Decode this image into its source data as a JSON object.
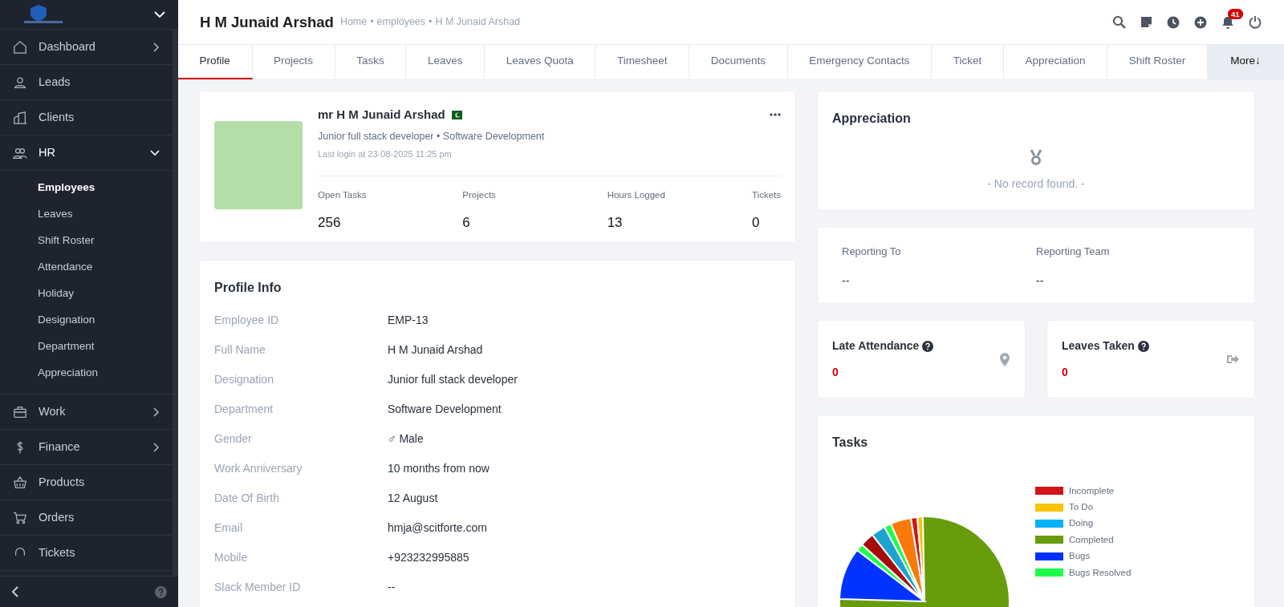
{
  "sidebar": {
    "items": [
      {
        "label": "Dashboard",
        "kind": "home",
        "expandable": true,
        "expanded": false
      },
      {
        "label": "Leads",
        "kind": "user",
        "expandable": false,
        "expanded": false
      },
      {
        "label": "Clients",
        "kind": "building",
        "expandable": false,
        "expanded": false
      },
      {
        "label": "HR",
        "kind": "users",
        "expandable": true,
        "expanded": true,
        "children": [
          {
            "label": "Employees",
            "selected": true
          },
          {
            "label": "Leaves",
            "selected": false
          },
          {
            "label": "Shift Roster",
            "selected": false
          },
          {
            "label": "Attendance",
            "selected": false
          },
          {
            "label": "Holiday",
            "selected": false
          },
          {
            "label": "Designation",
            "selected": false
          },
          {
            "label": "Department",
            "selected": false
          },
          {
            "label": "Appreciation",
            "selected": false
          }
        ]
      },
      {
        "label": "Work",
        "kind": "briefcase",
        "expandable": true,
        "expanded": false
      },
      {
        "label": "Finance",
        "kind": "dollar",
        "expandable": true,
        "expanded": false
      },
      {
        "label": "Products",
        "kind": "basket",
        "expandable": false,
        "expanded": false
      },
      {
        "label": "Orders",
        "kind": "cart",
        "expandable": false,
        "expanded": false
      },
      {
        "label": "Tickets",
        "kind": "headset",
        "expandable": false,
        "expanded": false
      }
    ]
  },
  "header": {
    "title": "H M Junaid Arshad",
    "breadcrumb": [
      "Home",
      "employees",
      "H M Junaid Arshad"
    ],
    "breadcrumb_separator": "•",
    "notification_count": "41"
  },
  "tabs": [
    {
      "label": "Profile",
      "selected": true
    },
    {
      "label": "Projects",
      "selected": false
    },
    {
      "label": "Tasks",
      "selected": false
    },
    {
      "label": "Leaves",
      "selected": false
    },
    {
      "label": "Leaves Quota",
      "selected": false
    },
    {
      "label": "Timesheet",
      "selected": false
    },
    {
      "label": "Documents",
      "selected": false
    },
    {
      "label": "Emergency Contacts",
      "selected": false
    },
    {
      "label": "Ticket",
      "selected": false
    },
    {
      "label": "Appreciation",
      "selected": false
    },
    {
      "label": "Shift Roster",
      "selected": false
    },
    {
      "label": "More↓",
      "selected": false,
      "kind": "more"
    }
  ],
  "profile": {
    "name": "mr H M Junaid Arshad",
    "subtitle": "Junior full stack developer • Software Development",
    "last_login": "Last login at 23-08-2025 11:25 pm",
    "stats": [
      {
        "label": "Open Tasks",
        "value": "256"
      },
      {
        "label": "Projects",
        "value": "6"
      },
      {
        "label": "Hours Logged",
        "value": "13"
      },
      {
        "label": "Tickets",
        "value": "0"
      }
    ]
  },
  "profile_info": {
    "title": "Profile Info",
    "rows": [
      {
        "label": "Employee ID",
        "value": "EMP-13"
      },
      {
        "label": "Full Name",
        "value": "H M Junaid Arshad"
      },
      {
        "label": "Designation",
        "value": "Junior full stack developer"
      },
      {
        "label": "Department",
        "value": "Software Development"
      },
      {
        "label": "Gender",
        "value": "♂ Male"
      },
      {
        "label": "Work Anniversary",
        "value": "10 months from now"
      },
      {
        "label": "Date Of Birth",
        "value": "12 August"
      },
      {
        "label": "Email",
        "value": "hmja@scitforte.com"
      },
      {
        "label": "Mobile",
        "value": "+923232995885"
      },
      {
        "label": "Slack Member ID",
        "value": "--"
      }
    ]
  },
  "appreciation": {
    "title": "Appreciation",
    "empty_text": "- No record found. -"
  },
  "reporting": [
    {
      "label": "Reporting To",
      "value": "--"
    },
    {
      "label": "Reporting Team",
      "value": "--"
    }
  ],
  "counters": [
    {
      "title": "Late Attendance",
      "value": "0",
      "kind": "pin"
    },
    {
      "title": "Leaves Taken",
      "value": "0",
      "kind": "exit"
    }
  ],
  "tasks": {
    "title": "Tasks",
    "legend": [
      {
        "label": "Incomplete",
        "color": "#d0141a"
      },
      {
        "label": "To Do",
        "color": "#f8c30a"
      },
      {
        "label": "Doing",
        "color": "#00b2f5"
      },
      {
        "label": "Completed",
        "color": "#679c0d"
      },
      {
        "label": "Bugs",
        "color": "#0033ff"
      },
      {
        "label": "Bugs Resolved",
        "color": "#1bff4a"
      }
    ]
  }
}
